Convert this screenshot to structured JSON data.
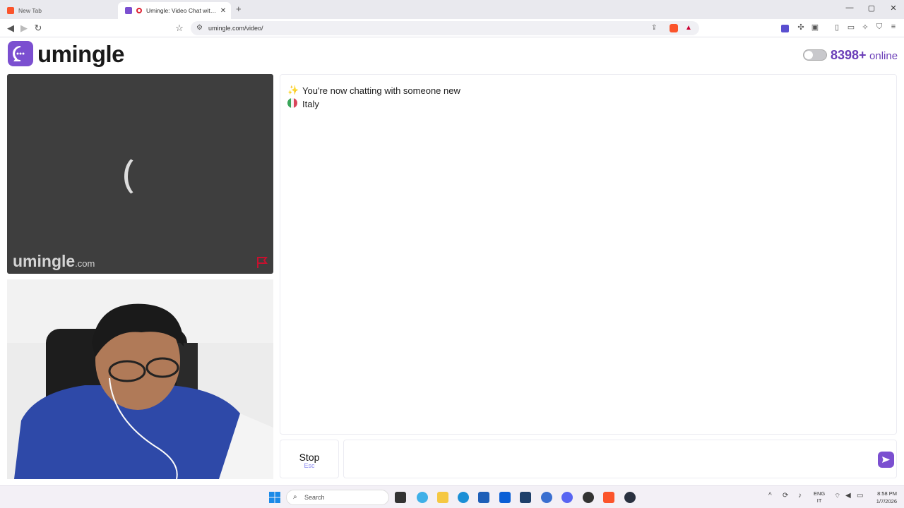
{
  "browser": {
    "tabs": [
      {
        "title": "New Tab",
        "favicon_color": "#fb542b"
      },
      {
        "title": "Umingle: Video Chat with Strangers",
        "favicon_color": "#7b4fd0"
      }
    ],
    "url": "umingle.com/video/",
    "icons": {
      "back": "◀",
      "forward": "▶",
      "reload": "↻",
      "bookmark": "☆",
      "share": "⇪",
      "minimize": "—",
      "maximize": "▢",
      "close": "✕",
      "new_tab": "+"
    }
  },
  "header": {
    "logo_text": "umingle",
    "online_count": "8398+",
    "online_label": "online",
    "accent_color": "#7b4fd0"
  },
  "video": {
    "watermark_main": "umingle",
    "watermark_suffix": ".com"
  },
  "chat": {
    "messages": [
      {
        "icon": "✨",
        "text": "You're now chatting with someone new"
      },
      {
        "icon": "🇮🇹",
        "text": "Italy"
      }
    ],
    "stop_label": "Stop",
    "stop_hint": "Esc",
    "input_value": ""
  },
  "taskbar": {
    "search_placeholder": "Search",
    "language_line1": "ENG",
    "language_line2": "IT",
    "time": "8:58 PM",
    "date": "1/7/2026"
  }
}
